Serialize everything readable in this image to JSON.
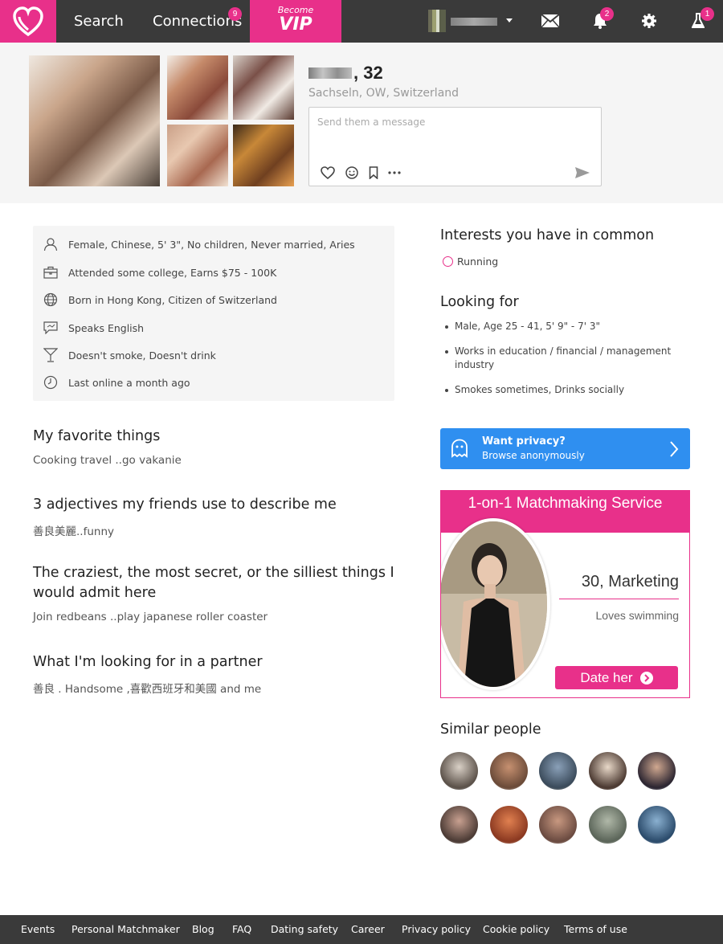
{
  "nav": {
    "search": "Search",
    "connections": "Connections",
    "connections_badge": "9",
    "vip_small": "Become",
    "vip_big": "VIP",
    "notifications_badge": "2",
    "lab_badge": "1"
  },
  "profile": {
    "age": ", 32",
    "location": "Sachseln, OW, Switzerland",
    "message_placeholder": "Send them a message"
  },
  "details": [
    {
      "icon": "person-icon",
      "text": "Female, Chinese, 5' 3\", No children, Never married, Aries"
    },
    {
      "icon": "briefcase-icon",
      "text": "Attended some college, Earns $75 - 100K"
    },
    {
      "icon": "globe-icon",
      "text": "Born in Hong Kong, Citizen of Switzerland"
    },
    {
      "icon": "speech-bubble-icon",
      "text": "Speaks English"
    },
    {
      "icon": "cocktail-icon",
      "text": "Doesn't smoke, Doesn't drink"
    },
    {
      "icon": "clock-icon",
      "text": "Last online a month ago"
    }
  ],
  "sections": [
    {
      "title": "My favorite things",
      "text": "Cooking travel ..go vakanie"
    },
    {
      "title": "3 adjectives my friends use to describe me",
      "text": "善良美麗..funny"
    },
    {
      "title": "The craziest, the most secret, or the silliest things I would admit here",
      "text": "Join redbeans ..play japanese roller coaster"
    },
    {
      "title": "What I'm looking for in a partner",
      "text": "善良 . Handsome ,喜歡西班牙和美國 and me"
    }
  ],
  "interests": {
    "title": "Interests you have in common",
    "items": [
      "Running"
    ]
  },
  "looking_for": {
    "title": "Looking for",
    "items": [
      "Male, Age 25 - 41, 5' 9\" - 7' 3\"",
      "Works in education / financial / management industry",
      "Smokes sometimes, Drinks socially"
    ]
  },
  "privacy": {
    "title": "Want privacy?",
    "subtitle": "Browse anonymously"
  },
  "ad": {
    "header": "1-on-1 Matchmaking Service",
    "title": "30, Marketing",
    "subtitle": "Loves swimming",
    "button": "Date her"
  },
  "similar": {
    "title": "Similar people"
  },
  "footer": [
    "Events",
    "Personal Matchmaker",
    "Blog",
    "FAQ",
    "Dating safety",
    "Career",
    "Privacy policy",
    "Cookie policy",
    "Terms of use"
  ],
  "colors": {
    "brand": "#e8308a",
    "topbar": "#3a3a3a",
    "privacy_blue": "#2f8ff0"
  }
}
